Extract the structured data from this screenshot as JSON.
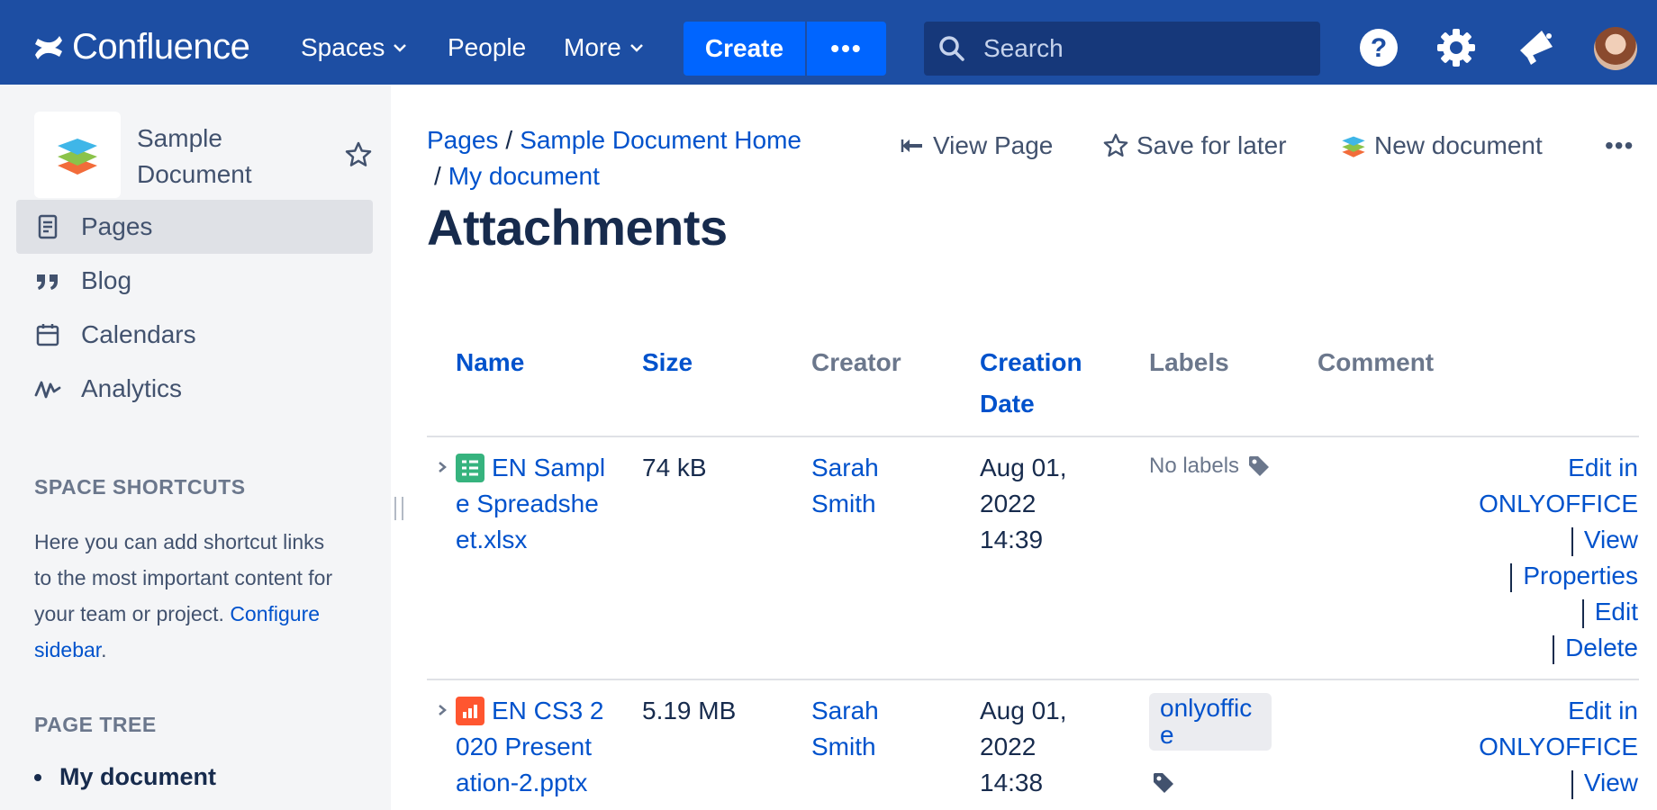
{
  "topnav": {
    "logo_text": "Confluence",
    "spaces": "Spaces",
    "people": "People",
    "more": "More",
    "create": "Create",
    "create_more": "•••",
    "search_placeholder": "Search",
    "bg_color": "#1d4ea3",
    "accent_color": "#0065ff"
  },
  "sidebar": {
    "space_name": "Sample Document",
    "items": [
      {
        "label": "Pages",
        "icon": "page-icon",
        "active": true
      },
      {
        "label": "Blog",
        "icon": "quote-icon",
        "active": false
      },
      {
        "label": "Calendars",
        "icon": "calendar-icon",
        "active": false
      },
      {
        "label": "Analytics",
        "icon": "analytics-icon",
        "active": false
      }
    ],
    "shortcuts_heading": "SPACE SHORTCUTS",
    "shortcuts_text": "Here you can add shortcut links to the most important content for your team or project.",
    "configure_link": "Configure sidebar",
    "configure_suffix": ".",
    "page_tree_heading": "PAGE TREE",
    "tree_items": [
      "My document"
    ]
  },
  "breadcrumbs": [
    "Pages",
    "Sample Document Home",
    "My document"
  ],
  "actions": {
    "view_page": "View Page",
    "save_for_later": "Save for later",
    "new_document": "New document",
    "more": "•••"
  },
  "page_title": "Attachments",
  "table": {
    "headers": {
      "name": "Name",
      "size": "Size",
      "creator": "Creator",
      "creation_date": "Creation Date",
      "labels": "Labels",
      "comment": "Comment"
    },
    "rows": [
      {
        "name": "EN Sample Spreadsheet.xlsx",
        "name_lines": [
          "EN Sampl",
          "e Spreadshe",
          "et.xlsx"
        ],
        "file_type": "spreadsheet-icon",
        "size": "74 kB",
        "creator_lines": [
          "Sarah",
          "Smith"
        ],
        "date_lines": [
          "Aug 01,",
          "2022",
          "14:39"
        ],
        "labels_text": "No labels",
        "label_chip_lines": [],
        "ops": [
          "Edit in",
          "ONLYOFFICE",
          "View",
          "Properties",
          "Edit",
          "Delete"
        ]
      },
      {
        "name": "EN CS3 2020 Presentation-2.pptx",
        "name_lines": [
          "EN CS3 2",
          "020 Present",
          "ation-2.pptx"
        ],
        "file_type": "presentation-icon",
        "size": "5.19 MB",
        "creator_lines": [
          "Sarah",
          "Smith"
        ],
        "date_lines": [
          "Aug 01,",
          "2022",
          "14:38"
        ],
        "labels_text": "",
        "label_chip_lines": [
          "onlyoffic",
          "e"
        ],
        "ops": [
          "Edit in",
          "ONLYOFFICE",
          "View"
        ]
      }
    ]
  }
}
